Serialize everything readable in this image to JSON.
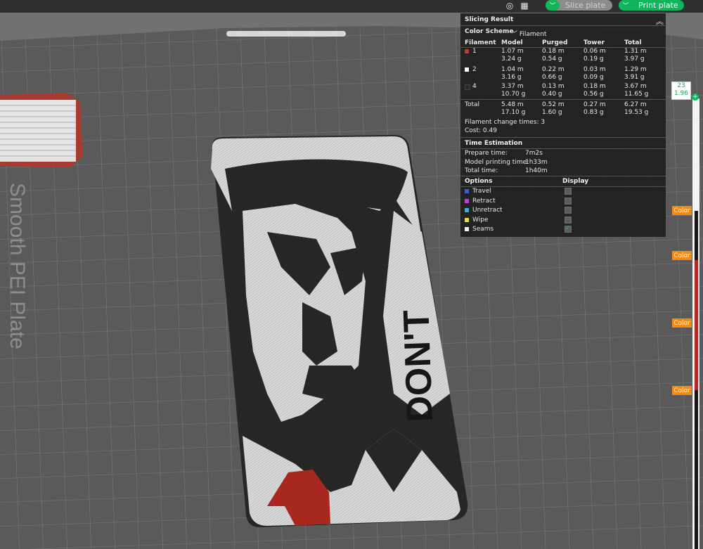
{
  "topbar": {
    "icons": [
      "spiral-icon",
      "layout-icon"
    ],
    "slice_label": "Slice plate",
    "print_label": "Print plate"
  },
  "plate": {
    "label": "Smooth PEI Plate",
    "model_text": "DON'T"
  },
  "panel": {
    "title": "Slicing Result",
    "color_scheme_label": "Color Scheme",
    "color_scheme_value": "Filament",
    "headers": [
      "Filament",
      "Model",
      "Purged",
      "Tower",
      "Total"
    ],
    "rows": [
      {
        "id": "1",
        "color": "#c0392b",
        "model": [
          "1.07 m",
          "3.24 g"
        ],
        "purged": [
          "0.18 m",
          "0.54 g"
        ],
        "tower": [
          "0.06 m",
          "0.19 g"
        ],
        "total": [
          "1.31 m",
          "3.97 g"
        ]
      },
      {
        "id": "2",
        "color": "#ffffff",
        "model": [
          "1.04 m",
          "3.16 g"
        ],
        "purged": [
          "0.22 m",
          "0.66 g"
        ],
        "tower": [
          "0.03 m",
          "0.09 g"
        ],
        "total": [
          "1.29 m",
          "3.91 g"
        ]
      },
      {
        "id": "4",
        "color": "#2a2a2a",
        "model": [
          "3.37 m",
          "10.70 g"
        ],
        "purged": [
          "0.13 m",
          "0.40 g"
        ],
        "tower": [
          "0.18 m",
          "0.56 g"
        ],
        "total": [
          "3.67 m",
          "11.65 g"
        ]
      }
    ],
    "total_row": {
      "label": "Total",
      "model": [
        "5.48 m",
        "17.10 g"
      ],
      "purged": [
        "0.52 m",
        "1.60 g"
      ],
      "tower": [
        "0.27 m",
        "0.83 g"
      ],
      "total": [
        "6.27 m",
        "19.53 g"
      ]
    },
    "filament_change": "Filament change times: 3",
    "cost": "Cost: 0.49",
    "time_title": "Time Estimation",
    "prepare_label": "Prepare time:",
    "prepare_value": "7m2s",
    "model_time_label": "Model printing time:",
    "model_time_value": "1h33m",
    "total_time_label": "Total time:",
    "total_time_value": "1h40m",
    "options_title": "Options",
    "display_title": "Display",
    "options": [
      {
        "label": "Travel",
        "color": "#3d5bd6",
        "checked": false
      },
      {
        "label": "Retract",
        "color": "#c040d8",
        "checked": false
      },
      {
        "label": "Unretract",
        "color": "#3ab0d8",
        "checked": false
      },
      {
        "label": "Wipe",
        "color": "#f0e020",
        "checked": false
      },
      {
        "label": "Seams",
        "color": "#f2f2f2",
        "checked": true
      }
    ]
  },
  "slider": {
    "layer": "23",
    "height": "1.96",
    "plus": "+",
    "color_labels": [
      "Color",
      "Color",
      "Color",
      "Color"
    ]
  }
}
